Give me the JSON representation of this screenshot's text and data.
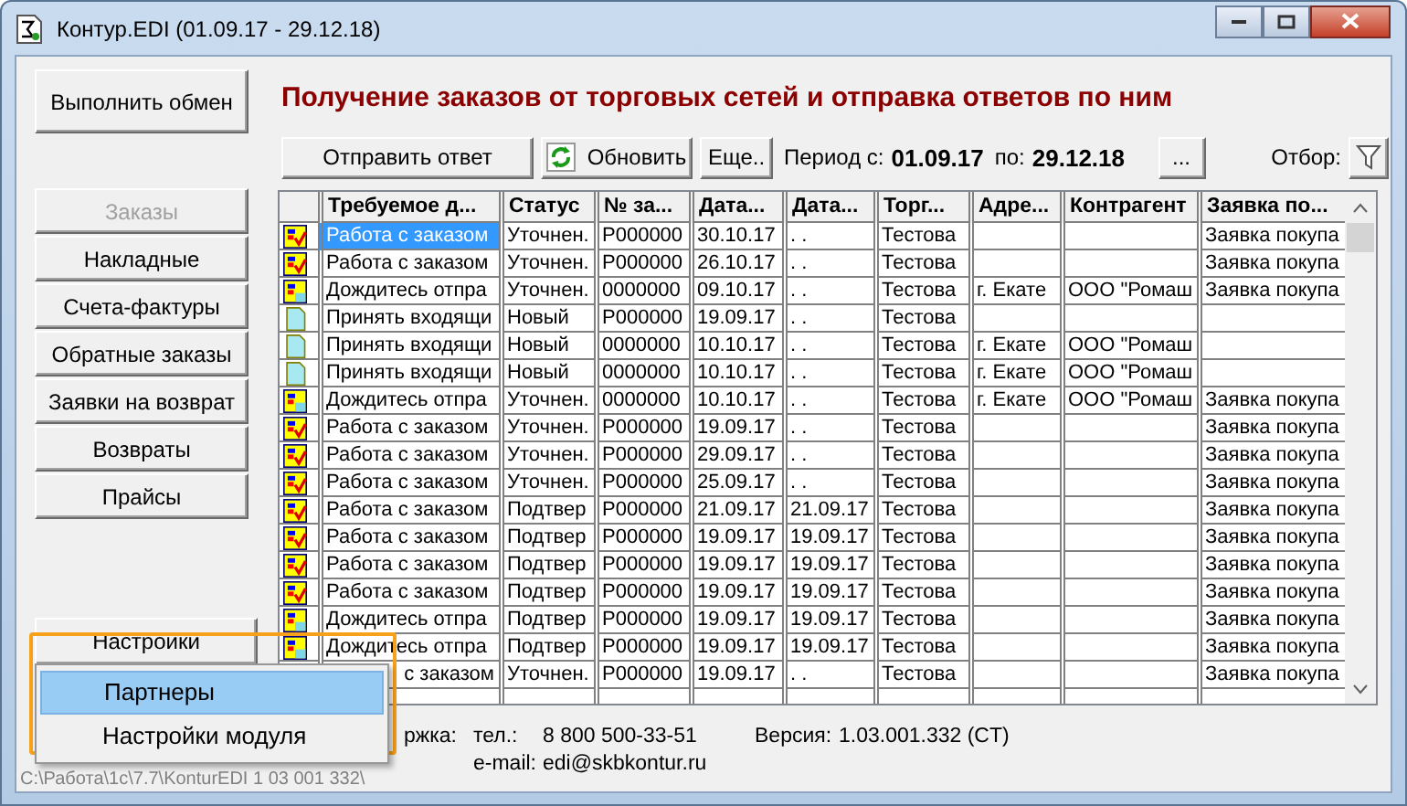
{
  "window": {
    "title": "Контур.EDI (01.09.17 - 29.12.18)"
  },
  "sidebar": {
    "exchange_button": "Выполнить обмен",
    "items": [
      {
        "label": "Заказы",
        "disabled": true
      },
      {
        "label": "Накладные",
        "disabled": false
      },
      {
        "label": "Счета-фактуры",
        "disabled": false
      },
      {
        "label": "Обратные заказы",
        "disabled": false
      },
      {
        "label": "Заявки на возврат",
        "disabled": false
      },
      {
        "label": "Возвраты",
        "disabled": false
      },
      {
        "label": "Прайсы",
        "disabled": false
      }
    ],
    "settings_button": "Настройки"
  },
  "heading": "Получение заказов от торговых сетей и отправка ответов по ним",
  "toolbar": {
    "send_button": "Отправить ответ",
    "refresh_button": "Обновить",
    "more_button": "Еще..",
    "period_from_label": "Период с:",
    "period_from": "01.09.17",
    "period_to_label": "по:",
    "period_to": "29.12.18",
    "period_button": "...",
    "filter_label": "Отбор:"
  },
  "table": {
    "columns": [
      "Требуемое д...",
      "Статус",
      "№ за...",
      "Дата...",
      "Дата...",
      "Торг...",
      "Адре...",
      "Контрагент",
      "Заявка по..."
    ],
    "rows": [
      {
        "kind": "work",
        "selected": true,
        "cells": [
          "Работа с заказом",
          "Уточнен.",
          "P000000",
          "30.10.17",
          ". .",
          "Тестова",
          "",
          "",
          "Заявка покупа"
        ]
      },
      {
        "kind": "work",
        "selected": false,
        "cells": [
          "Работа с заказом",
          "Уточнен.",
          "P000000",
          "26.10.17",
          ". .",
          "Тестова",
          "",
          "",
          "Заявка покупа"
        ]
      },
      {
        "kind": "wait",
        "selected": false,
        "cells": [
          "Дождитесь отпра",
          "Уточнен.",
          "0000000",
          "09.10.17",
          ". .",
          "Тестова",
          "г. Екате",
          "ООО \"Ромаш",
          "Заявка покупа"
        ]
      },
      {
        "kind": "new",
        "selected": false,
        "cells": [
          "Принять входящи",
          "Новый",
          "P000000",
          "19.09.17",
          ". .",
          "Тестова",
          "",
          "",
          ""
        ]
      },
      {
        "kind": "new",
        "selected": false,
        "cells": [
          "Принять входящи",
          "Новый",
          "0000000",
          "10.10.17",
          ". .",
          "Тестова",
          "г. Екате",
          "ООО \"Ромаш",
          ""
        ]
      },
      {
        "kind": "new",
        "selected": false,
        "cells": [
          "Принять входящи",
          "Новый",
          "0000000",
          "10.10.17",
          ". .",
          "Тестова",
          "г. Екате",
          "ООО \"Ромаш",
          ""
        ]
      },
      {
        "kind": "wait",
        "selected": false,
        "cells": [
          "Дождитесь отпра",
          "Уточнен.",
          "0000000",
          "10.10.17",
          ". .",
          "Тестова",
          "г. Екате",
          "ООО \"Ромаш",
          "Заявка покупа"
        ]
      },
      {
        "kind": "work",
        "selected": false,
        "cells": [
          "Работа с заказом",
          "Уточнен.",
          "P000000",
          "19.09.17",
          ". .",
          "Тестова",
          "",
          "",
          "Заявка покупа"
        ]
      },
      {
        "kind": "work",
        "selected": false,
        "cells": [
          "Работа с заказом",
          "Уточнен.",
          "P000000",
          "29.09.17",
          ". .",
          "Тестова",
          "",
          "",
          "Заявка покупа"
        ]
      },
      {
        "kind": "work",
        "selected": false,
        "cells": [
          "Работа с заказом",
          "Уточнен.",
          "P000000",
          "25.09.17",
          ". .",
          "Тестова",
          "",
          "",
          "Заявка покупа"
        ]
      },
      {
        "kind": "work",
        "selected": false,
        "cells": [
          "Работа с заказом",
          "Подтвер",
          "P000000",
          "21.09.17",
          "21.09.17",
          "Тестова",
          "",
          "",
          "Заявка покупа"
        ]
      },
      {
        "kind": "work",
        "selected": false,
        "cells": [
          "Работа с заказом",
          "Подтвер",
          "P000000",
          "19.09.17",
          "19.09.17",
          "Тестова",
          "",
          "",
          "Заявка покупа"
        ]
      },
      {
        "kind": "work",
        "selected": false,
        "cells": [
          "Работа с заказом",
          "Подтвер",
          "P000000",
          "19.09.17",
          "19.09.17",
          "Тестова",
          "",
          "",
          "Заявка покупа"
        ]
      },
      {
        "kind": "work",
        "selected": false,
        "cells": [
          "Работа с заказом",
          "Подтвер",
          "P000000",
          "19.09.17",
          "19.09.17",
          "Тестова",
          "",
          "",
          "Заявка покупа"
        ]
      },
      {
        "kind": "wait",
        "selected": false,
        "cells": [
          "Дождитесь отпра",
          "Подтвер",
          "P000000",
          "19.09.17",
          "19.09.17",
          "Тестова",
          "",
          "",
          "Заявка покупа"
        ]
      },
      {
        "kind": "wait",
        "selected": false,
        "cells": [
          "Дождитесь отпра",
          "Подтвер",
          "P000000",
          "19.09.17",
          "19.09.17",
          "Тестова",
          "",
          "",
          "Заявка покупа"
        ]
      },
      {
        "kind": "covered",
        "selected": false,
        "cells": [
          "с заказом",
          "Уточнен.",
          "P000000",
          "19.09.17",
          ". .",
          "Тестова",
          "",
          "",
          "Заявка покупа"
        ]
      }
    ]
  },
  "popup_menu": {
    "items": [
      {
        "label": "Партнеры",
        "selected": true
      },
      {
        "label": "Настройки модуля",
        "selected": false
      }
    ]
  },
  "support": {
    "label": "ржка:",
    "phone_label": "тел.:",
    "phone": "8 800 500-33-51",
    "version_label": "Версия:",
    "version": "1.03.001.332 (CT)",
    "email_label": "e-mail:",
    "email": "edi@skbkontur.ru"
  },
  "status_bar": {
    "path": "C:\\Работа\\1с\\7.7\\KonturEDI 1 03 001 332\\"
  }
}
